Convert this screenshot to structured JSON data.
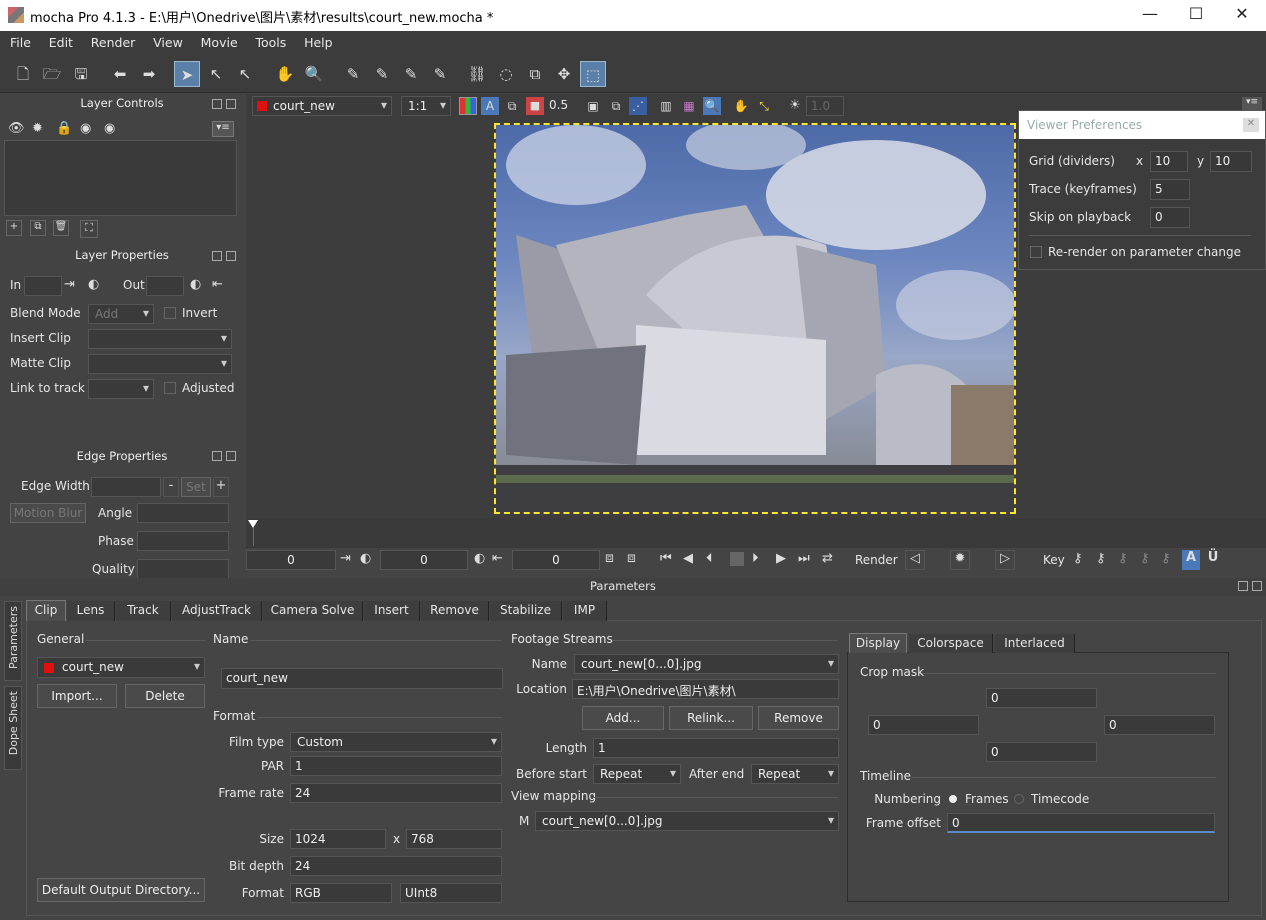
{
  "titlebar": {
    "title": "mocha Pro 4.1.3 - E:\\用户\\Onedrive\\图片\\素材\\results\\court_new.mocha *",
    "minimize": "—",
    "maximize": "☐",
    "close": "✕"
  },
  "menu": [
    "File",
    "Edit",
    "Render",
    "View",
    "Movie",
    "Tools",
    "Help"
  ],
  "layer_controls": {
    "title": "Layer Controls"
  },
  "layer_properties": {
    "title": "Layer Properties",
    "in_label": "In",
    "out_label": "Out",
    "blend_mode_label": "Blend Mode",
    "blend_mode_value": "Add",
    "invert_label": "Invert",
    "insert_clip_label": "Insert Clip",
    "matte_clip_label": "Matte Clip",
    "link_to_track_label": "Link to track",
    "adjusted_label": "Adjusted"
  },
  "edge_properties": {
    "title": "Edge Properties",
    "edge_width_label": "Edge Width",
    "set_label": "Set",
    "motion_blur_label": "Motion Blur",
    "angle_label": "Angle",
    "phase_label": "Phase",
    "quality_label": "Quality"
  },
  "viewer_bar": {
    "clip_name": "court_new",
    "zoom": "1:1",
    "opacity": "0.5",
    "exposure": "1.0"
  },
  "viewer_prefs": {
    "title": "Viewer Preferences",
    "grid_label": "Grid (dividers)",
    "x_label": "x",
    "y_label": "y",
    "grid_x": "10",
    "grid_y": "10",
    "trace_label": "Trace (keyframes)",
    "trace_value": "5",
    "skip_label": "Skip on playback",
    "skip_value": "0",
    "rerender_label": "Re-render on parameter change"
  },
  "timeline": {
    "in_value": "0",
    "current_value": "0",
    "out_value": "0",
    "render_label": "Render",
    "key_label": "Key"
  },
  "parameters_title": "Parameters",
  "side_tabs": [
    "Parameters",
    "Dope Sheet"
  ],
  "tabs": [
    "Clip",
    "Lens",
    "Track",
    "AdjustTrack",
    "Camera Solve",
    "Insert",
    "Remove",
    "Stabilize",
    "IMP"
  ],
  "clip": {
    "general_label": "General",
    "clip_value": "court_new",
    "import_label": "Import...",
    "delete_label": "Delete",
    "default_output_label": "Default Output Directory...",
    "name_label": "Name",
    "name_value": "court_new",
    "format_label": "Format",
    "film_type_label": "Film type",
    "film_type_value": "Custom",
    "par_label": "PAR",
    "par_value": "1",
    "frame_rate_label": "Frame rate",
    "frame_rate_value": "24",
    "size_label": "Size",
    "size_w": "1024",
    "size_x": "x",
    "size_h": "768",
    "bit_depth_label": "Bit depth",
    "bit_depth_value": "24",
    "format_field_label": "Format",
    "format_value": "RGB",
    "format_type": "UInt8",
    "footage_label": "Footage Streams",
    "fs_name_label": "Name",
    "fs_name_value": "court_new[0...0].jpg",
    "location_label": "Location",
    "location_value": "E:\\用户\\Onedrive\\图片\\素材\\",
    "add_label": "Add...",
    "relink_label": "Relink...",
    "remove_label": "Remove",
    "length_label": "Length",
    "length_value": "1",
    "before_start_label": "Before start",
    "before_start_value": "Repeat",
    "after_end_label": "After end",
    "after_end_value": "Repeat",
    "view_mapping_label": "View mapping",
    "m_label": "M",
    "m_value": "court_new[0...0].jpg"
  },
  "display": {
    "tabs": [
      "Display",
      "Colorspace",
      "Interlaced"
    ],
    "crop_mask_label": "Crop mask",
    "crop_top": "0",
    "crop_left": "0",
    "crop_right": "0",
    "crop_bottom": "0",
    "timeline_label": "Timeline",
    "numbering_label": "Numbering",
    "frames_label": "Frames",
    "timecode_label": "Timecode",
    "frame_offset_label": "Frame offset",
    "frame_offset_value": "0"
  }
}
